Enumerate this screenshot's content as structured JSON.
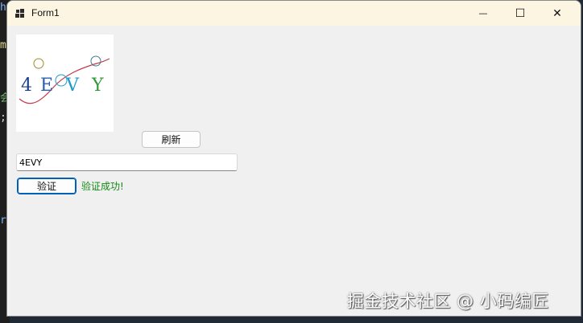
{
  "background_editor": {
    "glyphs": [
      {
        "text": "h",
        "color": "#7fb2ff"
      },
      {
        "text": "m",
        "color": "#dcdc8b"
      },
      {
        "text": "会",
        "color": "#6fb36f"
      },
      {
        "text": ";",
        "color": "#d4d4d4"
      },
      {
        "text": "r",
        "color": "#7fb2ff"
      }
    ]
  },
  "window": {
    "title": "Form1",
    "icon": "winforms-app-icon",
    "controls": {
      "minimize_glyph": "—",
      "maximize_glyph": "☐",
      "close_glyph": "✕"
    }
  },
  "captcha": {
    "text": "4EVY",
    "chars": [
      {
        "char": "4",
        "color": "#1a3d8f"
      },
      {
        "char": "E",
        "color": "#2a5fb0"
      },
      {
        "char": "V",
        "color": "#1d9ac9"
      },
      {
        "char": "Y",
        "color": "#2f9a3a"
      }
    ],
    "noise_colors": {
      "circle_1": "#a08a28",
      "circle_2": "#1d9ac9",
      "circle_3": "#3a7a8a",
      "curve": "#c23a4a"
    }
  },
  "buttons": {
    "refresh_label": "刷新",
    "verify_label": "验证"
  },
  "input": {
    "value": "4EVY"
  },
  "status": {
    "text": "验证成功!",
    "color": "#138a13"
  },
  "watermark": {
    "text": "掘金技术社区 @ 小码编匠"
  }
}
